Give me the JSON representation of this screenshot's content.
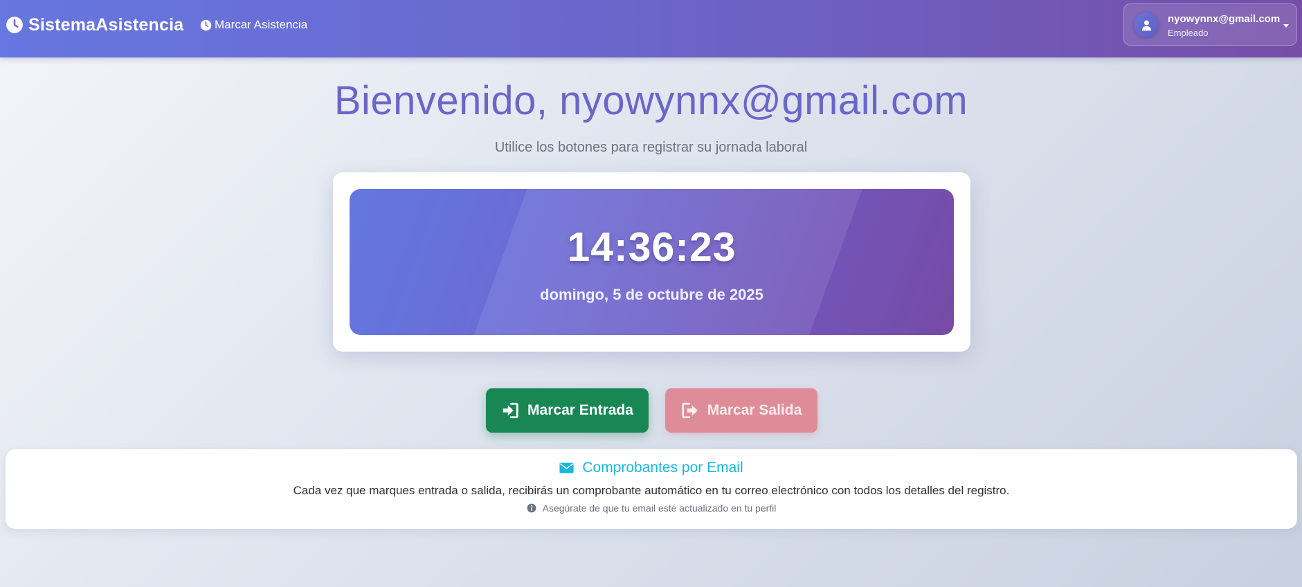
{
  "navbar": {
    "brand": "SistemaAsistencia",
    "brand_icon": "clock-icon",
    "links": [
      {
        "label": "Marcar Asistencia",
        "icon": "clock-icon"
      }
    ],
    "user": {
      "email": "nyowynnx@gmail.com",
      "role": "Empleado",
      "avatar_icon": "user-icon"
    }
  },
  "main": {
    "welcome": "Bienvenido, nyowynnx@gmail.com",
    "subtitle": "Utilice los botones para registrar su jornada laboral",
    "clock": {
      "time": "14:36:23",
      "date": "domingo, 5 de octubre de 2025"
    },
    "buttons": {
      "check_in": {
        "label": "Marcar Entrada",
        "icon": "sign-in-icon",
        "color": "#198754"
      },
      "check_out": {
        "label": "Marcar Salida",
        "icon": "sign-out-icon",
        "color": "#de8d98"
      }
    }
  },
  "email_info": {
    "title": "Comprobantes por Email",
    "icon": "envelope-icon",
    "text": "Cada vez que marques entrada o salida, recibirás un comprobante automático en tu correo electrónico con todos los detalles del registro.",
    "note": "Asegúrate de que tu email esté actualizado en tu perfil",
    "note_icon": "info-icon"
  },
  "colors": {
    "navbar_start": "#6677e0",
    "navbar_end": "#764ea8",
    "accent": "#6a66c8",
    "info": "#17b8d9"
  }
}
